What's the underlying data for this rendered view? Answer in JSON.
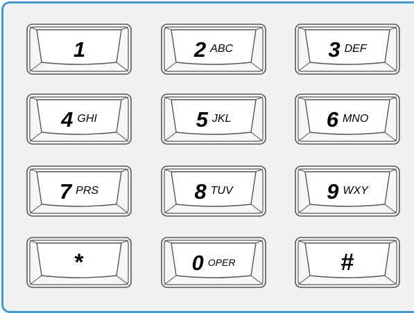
{
  "keypad": {
    "keys": [
      {
        "digit": "1",
        "letters": ""
      },
      {
        "digit": "2",
        "letters": "ABC"
      },
      {
        "digit": "3",
        "letters": "DEF"
      },
      {
        "digit": "4",
        "letters": "GHI"
      },
      {
        "digit": "5",
        "letters": "JKL"
      },
      {
        "digit": "6",
        "letters": "MNO"
      },
      {
        "digit": "7",
        "letters": "PRS"
      },
      {
        "digit": "8",
        "letters": "TUV"
      },
      {
        "digit": "9",
        "letters": "WXY"
      },
      {
        "digit": "*",
        "letters": ""
      },
      {
        "digit": "0",
        "letters": "OPER"
      },
      {
        "digit": "#",
        "letters": ""
      }
    ]
  },
  "colors": {
    "border": "#3d9ad9",
    "panel_background": "#f1f1f1",
    "key_outline": "#555555"
  }
}
